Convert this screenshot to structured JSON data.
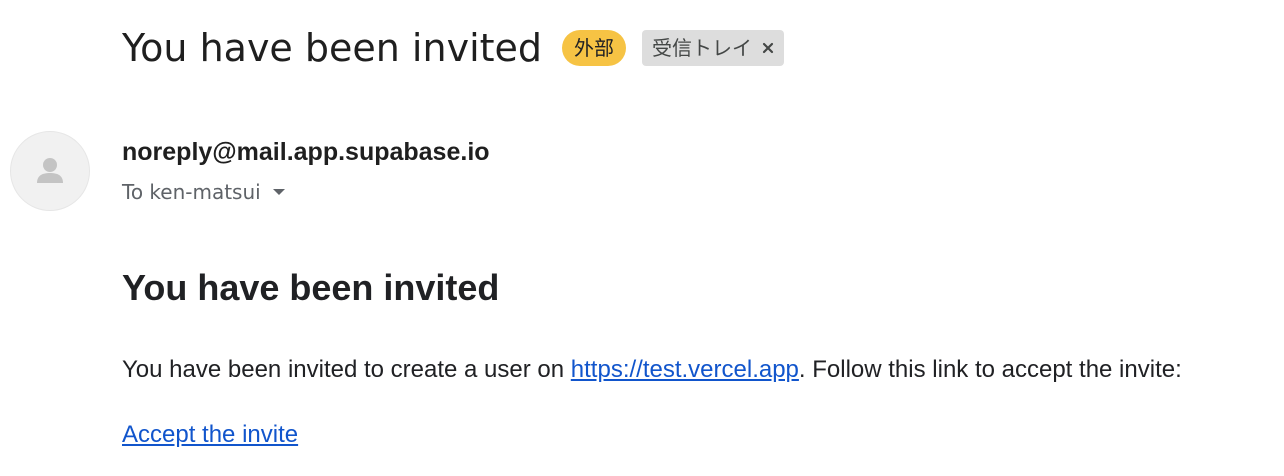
{
  "email": {
    "subject": "You have been invited",
    "labels": {
      "external": "外部",
      "inbox": "受信トレイ"
    },
    "sender": "noreply@mail.app.supabase.io",
    "recipient": "To ken-matsui",
    "body": {
      "heading": "You have been invited",
      "text_before_link": "You have been invited to create a user on ",
      "site_link": "https://test.vercel.app",
      "text_after_link": ". Follow this link to accept the invite:",
      "accept_link": "Accept the invite"
    }
  },
  "icons": {
    "avatar": "person-icon",
    "remove_label": "close-icon",
    "recipient_details": "caret-down-icon"
  },
  "colors": {
    "external_badge": "#f6c344",
    "inbox_badge": "#dddddd",
    "link": "#1155cc"
  }
}
